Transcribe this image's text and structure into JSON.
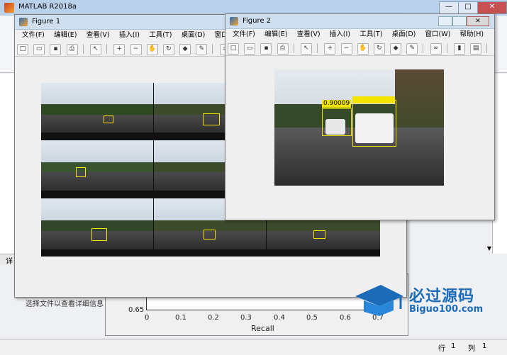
{
  "matlab": {
    "title": "MATLAB R2018a",
    "window_buttons": [
      "—",
      "□",
      "✕"
    ],
    "detail_label": "详",
    "hint_text": "选择文件以查看详细信息",
    "status": {
      "row_label": "行",
      "row_value": "1",
      "col_label": "列",
      "col_value": "1"
    }
  },
  "pr_plot": {
    "y_tick": "0.65",
    "x_ticks": [
      "0",
      "0.1",
      "0.2",
      "0.3",
      "0.4",
      "0.5",
      "0.6",
      "0.7"
    ],
    "xlabel": "Recall"
  },
  "figure1": {
    "title": "Figure 1",
    "menus": [
      "文件(F)",
      "编辑(E)",
      "查看(V)",
      "插入(I)",
      "工具(T)",
      "桌面(D)",
      "窗口(W)"
    ]
  },
  "figure2": {
    "title": "Figure 2",
    "menus": [
      "文件(F)",
      "编辑(E)",
      "查看(V)",
      "插入(I)",
      "工具(T)",
      "桌面(D)",
      "窗口(W)",
      "帮助(H)"
    ],
    "detection_score": "0.90009"
  },
  "toolbar_icons": [
    "new-icon",
    "open-icon",
    "save-icon",
    "print-icon",
    "pointer-icon",
    "zoom-in-icon",
    "zoom-out-icon",
    "pan-icon",
    "rotate-icon",
    "datatip-icon",
    "brush-icon",
    "link-icon",
    "colorbar-icon",
    "legend-icon",
    "hide-tools-icon",
    "show-tools-icon"
  ],
  "logo": {
    "main": "必过源码",
    "sub": "Biguo100.com"
  },
  "colors": {
    "bbox": "#f2e600",
    "titlebar": "#cfdff0",
    "logo_blue": "#1c6bb9"
  }
}
